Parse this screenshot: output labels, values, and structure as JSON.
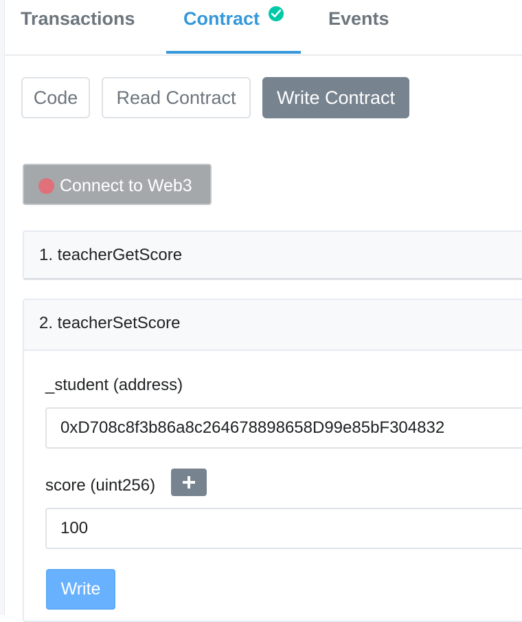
{
  "tabs": {
    "transactions": "Transactions",
    "contract": "Contract",
    "events": "Events"
  },
  "subtabs": {
    "code": "Code",
    "read": "Read Contract",
    "write": "Write Contract"
  },
  "connect": {
    "label": "Connect to Web3"
  },
  "functions": [
    {
      "title": "1. teacherGetScore"
    },
    {
      "title": "2. teacherSetScore",
      "inputs": [
        {
          "label": "_student (address)",
          "value": "0xD708c8f3b86a8c264678898658D99e85bF304832"
        },
        {
          "label": "score (uint256)",
          "value": "100"
        }
      ],
      "write_label": "Write"
    }
  ],
  "colors": {
    "accent": "#3498db",
    "verified": "#00c9a7",
    "active_subtab": "#77838f",
    "write_button": "#68b1ff",
    "disconnected_dot": "#e0707a"
  },
  "icons": {
    "verified": "check-circle-icon",
    "connect_status": "status-dot-icon",
    "add_input": "plus-icon"
  }
}
